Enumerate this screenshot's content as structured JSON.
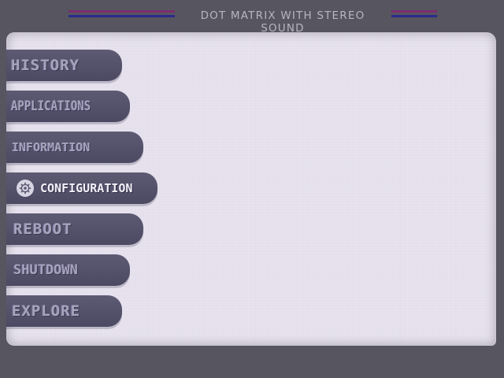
{
  "header": {
    "title": "DOT MATRIX WITH STEREO SOUND",
    "stripe_colors": [
      "#7a2d6e",
      "#2b2a8c"
    ]
  },
  "menu": {
    "items": [
      {
        "label": "HISTORY",
        "active": false
      },
      {
        "label": "APPLICATIONS",
        "active": false
      },
      {
        "label": "INFORMATION",
        "active": false
      },
      {
        "label": "CONFIGURATION",
        "active": true,
        "icon": "gear-icon"
      },
      {
        "label": "REBOOT",
        "active": false
      },
      {
        "label": "SHUTDOWN",
        "active": false
      },
      {
        "label": "EXPLORE",
        "active": false
      }
    ]
  },
  "colors": {
    "background": "#57555f",
    "screen": "#e5e0ee",
    "menu_item": "#57546c",
    "menu_text": "#a7a3bd",
    "active_text": "#f2f0f8"
  }
}
